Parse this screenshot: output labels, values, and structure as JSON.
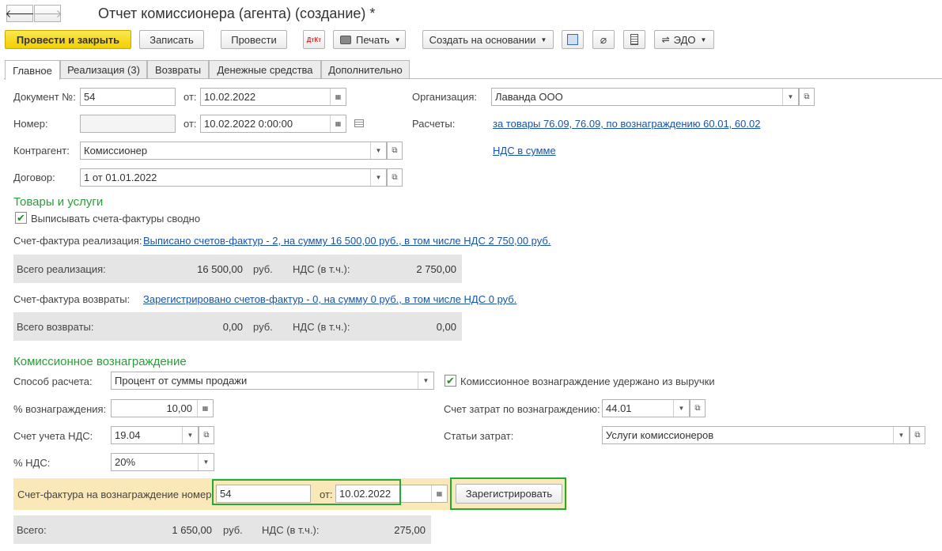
{
  "window": {
    "title": "Отчет комиссионера (агента) (создание) *"
  },
  "nav": {
    "back": "🡐",
    "forward": "🡒"
  },
  "toolbar": {
    "post_close": "Провести и закрыть",
    "save": "Записать",
    "post": "Провести",
    "dt_kt": "ДтКт",
    "print": "Печать",
    "create_based": "Создать на основании",
    "edo": "ЭДО"
  },
  "tabs": [
    "Главное",
    "Реализация (3)",
    "Возвраты",
    "Денежные средства",
    "Дополнительно"
  ],
  "header": {
    "doc_no_label": "Документ №:",
    "doc_no": "54",
    "from_label": "от:",
    "doc_date": "10.02.2022",
    "number_label": "Номер:",
    "number": "",
    "from2_label": "от:",
    "number_date": "10.02.2022  0:00:00",
    "org_label": "Организация:",
    "org": "Лаванда ООО",
    "settlements_label": "Расчеты:",
    "settlements_link": "за товары 76.09, 76.09, по вознаграждению 60.01, 60.02",
    "vat_link": "НДС в сумме",
    "contractor_label": "Контрагент:",
    "contractor": "Комиссионер",
    "contract_label": "Договор:",
    "contract": "1 от 01.01.2022"
  },
  "goods": {
    "section": "Товары и услуги",
    "combined_invoices": "Выписывать счета-фактуры сводно",
    "sales_invoice_label": "Счет-фактура реализация:",
    "sales_invoice_link": "Выписано счетов-фактур - 2, на сумму 16 500,00 руб., в том числе НДС 2 750,00 руб.",
    "total_sales_label": "Всего реализация:",
    "total_sales": "16 500,00",
    "currency": "руб.",
    "vat_incl_label": "НДС (в т.ч.):",
    "total_sales_vat": "2 750,00",
    "returns_invoice_label": "Счет-фактура возвраты:",
    "returns_invoice_link": "Зарегистрировано счетов-фактур - 0, на сумму 0 руб., в том числе НДС 0 руб.",
    "total_returns_label": "Всего возвраты:",
    "total_returns": "0,00",
    "total_returns_vat": "0,00"
  },
  "commission": {
    "section": "Комиссионное вознаграждение",
    "method_label": "Способ расчета:",
    "method": "Процент от суммы продажи",
    "withheld_label": "Комиссионное вознаграждение удержано из выручки",
    "percent_label": "% вознаграждения:",
    "percent": "10,00",
    "cost_account_label": "Счет затрат по вознаграждению:",
    "cost_account": "44.01",
    "vat_account_label": "Счет учета НДС:",
    "vat_account": "19.04",
    "cost_items_label": "Статьи затрат:",
    "cost_items": "Услуги комиссионеров",
    "vat_rate_label": "% НДС:",
    "vat_rate": "20%",
    "invoice_no_label": "Счет-фактура на вознаграждение номер:",
    "invoice_no": "54",
    "invoice_from_label": "от:",
    "invoice_date": "10.02.2022",
    "register": "Зарегистрировать",
    "total_label": "Всего:",
    "total": "1 650,00",
    "currency": "руб.",
    "vat_label": "НДС (в т.ч.):",
    "total_vat": "275,00"
  }
}
